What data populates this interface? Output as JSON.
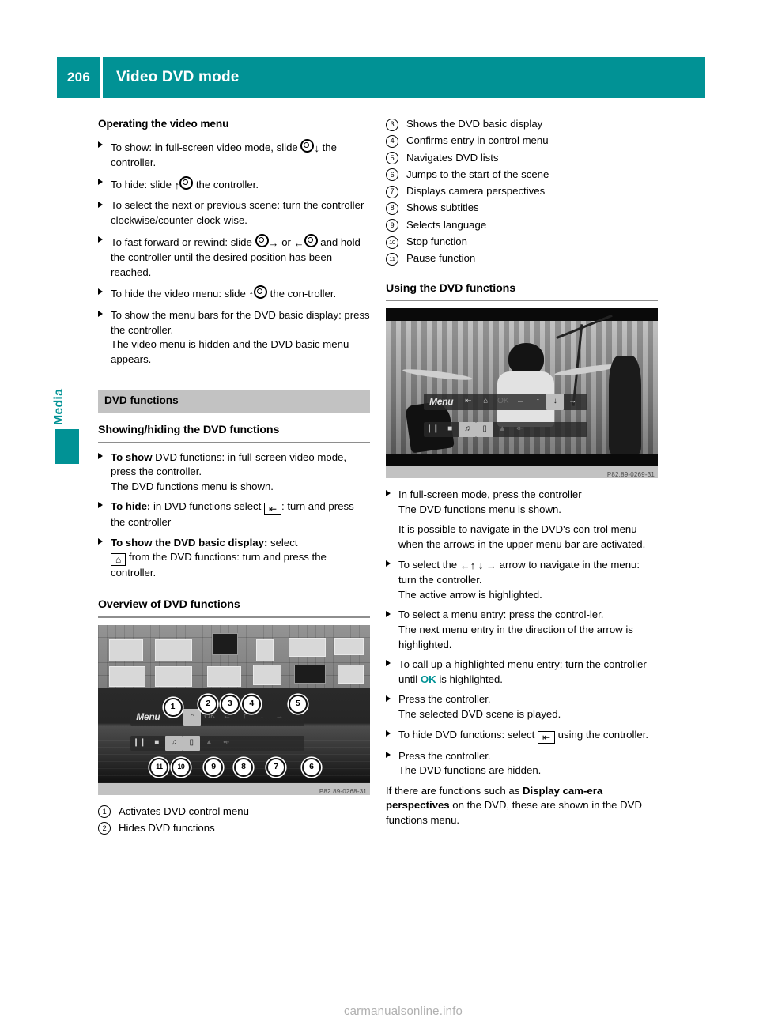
{
  "header": {
    "page_number": "206",
    "title": "Video DVD mode",
    "accent_color": "#019295"
  },
  "side_tab": {
    "label": "Media"
  },
  "left_column": {
    "heading_operating": "Operating the video menu",
    "items": [
      {
        "prefix": "To show: in full-screen video mode, slide",
        "suffix": "the controller."
      },
      {
        "prefix": "To hide: slide",
        "suffix": "the controller."
      },
      {
        "text": "To select the next or previous scene: turn the controller clockwise/counter-clock-wise."
      },
      {
        "prefix": "To fast forward or rewind: slide",
        "mid": "or",
        "suffix": "and hold the controller until the desired position has been reached."
      },
      {
        "prefix": "To hide the video menu: slide",
        "suffix": "the con-troller."
      },
      {
        "text": "To show the menu bars for the DVD basic display: press the controller.",
        "note": "The video menu is hidden and the DVD basic menu appears."
      }
    ],
    "section_bar": "DVD functions",
    "heading_showhide": "Showing/hiding the DVD functions",
    "showhide_items": [
      {
        "bold": "To show",
        "rest": " DVD functions: in full-screen video mode, press the controller.",
        "note": "The DVD functions menu is shown."
      },
      {
        "bold": "To hide:",
        "rest": " in DVD functions select",
        "after": ": turn and press the controller"
      },
      {
        "bold": "To show the DVD basic display:",
        "rest": " select",
        "after": "from the DVD functions: turn and press the controller."
      }
    ],
    "heading_overview": "Overview of DVD functions",
    "figure_caption": "P82.89-0268-31",
    "figure_menu": {
      "menu_label": "Menu",
      "top_icons": [
        "back-icon",
        "home-icon",
        "OK",
        "←",
        "↑",
        "↓",
        "→"
      ],
      "bottom_icons": [
        "pause-icon",
        "stop-icon",
        "language-icon",
        "subtitle-icon",
        "camera-icon",
        "scene-start-icon"
      ],
      "callouts": [
        "1",
        "2",
        "3",
        "4",
        "5",
        "6",
        "7",
        "8",
        "9",
        "10",
        "11"
      ]
    },
    "callouts": [
      {
        "num": "1",
        "text": "Activates DVD control menu"
      },
      {
        "num": "2",
        "text": "Hides DVD functions"
      }
    ]
  },
  "right_column": {
    "callouts": [
      {
        "num": "3",
        "text": "Shows the DVD basic display"
      },
      {
        "num": "4",
        "text": "Confirms entry in control menu"
      },
      {
        "num": "5",
        "text": "Navigates DVD lists"
      },
      {
        "num": "6",
        "text": "Jumps to the start of the scene"
      },
      {
        "num": "7",
        "text": "Displays camera perspectives"
      },
      {
        "num": "8",
        "text": "Shows subtitles"
      },
      {
        "num": "9",
        "text": "Selects language"
      },
      {
        "num": "10",
        "text": "Stop function"
      },
      {
        "num": "11",
        "text": "Pause function"
      }
    ],
    "heading_using": "Using the DVD functions",
    "figure_caption": "P82.89-0269-31",
    "items": [
      {
        "text": "In full-screen mode, press the controller",
        "note": "The DVD functions menu is shown."
      },
      {
        "paragraph": "It is possible to navigate in the DVD's con-trol menu when the arrows in the upper menu bar are activated."
      },
      {
        "prefix": "To select the",
        "arrows": "←↑ ↓ →",
        "suffix": "arrow to navigate in the menu: turn the controller.",
        "note": "The active arrow is highlighted."
      },
      {
        "text": "To select a menu entry: press the control-ler.",
        "note": "The next menu entry in the direction of the arrow is highlighted."
      },
      {
        "prefix": "To call up a highlighted menu entry: turn the controller until",
        "highlight": "OK",
        "suffix": "is highlighted."
      },
      {
        "text": "Press the controller.",
        "note": "The selected DVD scene is played."
      },
      {
        "prefix": "To hide DVD functions: select",
        "suffix": "using the controller."
      },
      {
        "text": "Press the controller.",
        "note": "The DVD functions are hidden."
      }
    ],
    "closing": {
      "a": "If there are functions such as ",
      "bold": "Display cam-era perspectives",
      "b": " on the DVD, these are shown in the DVD functions menu."
    }
  },
  "footer": {
    "watermark": "carmanualsonline.info"
  }
}
